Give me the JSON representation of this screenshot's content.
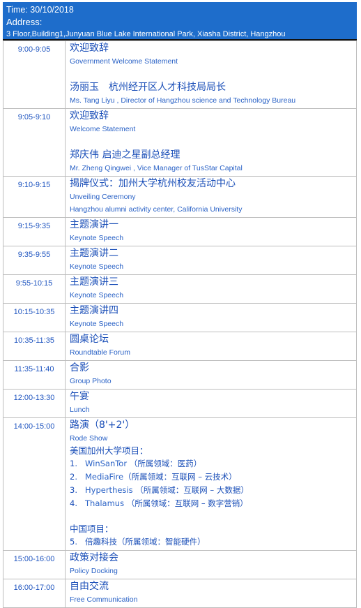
{
  "header": {
    "time": "Time: 30/10/2018",
    "address_label": "Address:",
    "address": "3 Floor,Building1,Junyuan Blue Lake International Park, Xiasha District, Hangzhou"
  },
  "colors": {
    "header_bg": "#1e6dcb",
    "text_blue": "#1b4fb8",
    "english_blue": "#2a62c6",
    "border": "#bdbdbd"
  },
  "rows": [
    {
      "time": "9:00-9:05",
      "zh": "欢迎致辞",
      "en": "Government Welcome Statement",
      "speaker_zh": "汤丽玉　杭州经开区人才科技局局长",
      "speaker_en": "Ms. Tang Liyu , Director of Hangzhou science and Technology Bureau"
    },
    {
      "time": "9:05-9:10",
      "zh": "欢迎致辞",
      "en": "Welcome Statement",
      "speaker_zh": "郑庆伟 启迪之星副总经理",
      "speaker_en": "Mr. Zheng Qingwei , Vice Manager of TusStar Capital"
    },
    {
      "time": "9:10-9:15",
      "zh": "揭牌仪式：加州大学杭州校友活动中心",
      "en": "Unveiling Ceremony",
      "en2": "Hangzhou alumni activity center, California University"
    },
    {
      "time": "9:15-9:35",
      "zh": "主题演讲一",
      "en": "Keynote Speech"
    },
    {
      "time": "9:35-9:55",
      "zh": "主题演讲二",
      "en": "Keynote Speech"
    },
    {
      "time": "9:55-10:15",
      "zh": "主题演讲三",
      "en": "Keynote Speech"
    },
    {
      "time": "10:15-10:35",
      "zh": "主题演讲四",
      "en": "Keynote Speech"
    },
    {
      "time": "10:35-11:35",
      "zh": "圆桌论坛",
      "en": "Roundtable Forum"
    },
    {
      "time": "11:35-11:40",
      "zh": "合影",
      "en": "Group Photo"
    },
    {
      "time": "12:00-13:30",
      "zh": "午宴",
      "en": "Lunch"
    },
    {
      "time": "14:00-15:00",
      "zh": "路演（8'+2'）",
      "en": "Rode Show",
      "us_heading": "美国加州大学项目：",
      "us_projects": [
        {
          "num": "1.",
          "name": "WinSanTor",
          "field": " （所属领域：医药）"
        },
        {
          "num": "2.",
          "name": "MediaFire",
          "field": "（所属领域：互联网 – 云技术）"
        },
        {
          "num": "3.",
          "name": "Hyperthesis",
          "field": " （所属领域：互联网 – 大数据）"
        },
        {
          "num": "4.",
          "name": "Thalamus",
          "field": " （所属领域：互联网 – 数字营销）"
        }
      ],
      "cn_heading": "中国项目：",
      "cn_projects": [
        {
          "num": "5.",
          "name": "倍趣科技",
          "field": "（所属领域：智能硬件）"
        }
      ]
    },
    {
      "time": "15:00-16:00",
      "zh": "政策对接会",
      "en": "Policy Docking"
    },
    {
      "time": "16:00-17:00",
      "zh": "自由交流",
      "en": "Free Communication"
    }
  ]
}
